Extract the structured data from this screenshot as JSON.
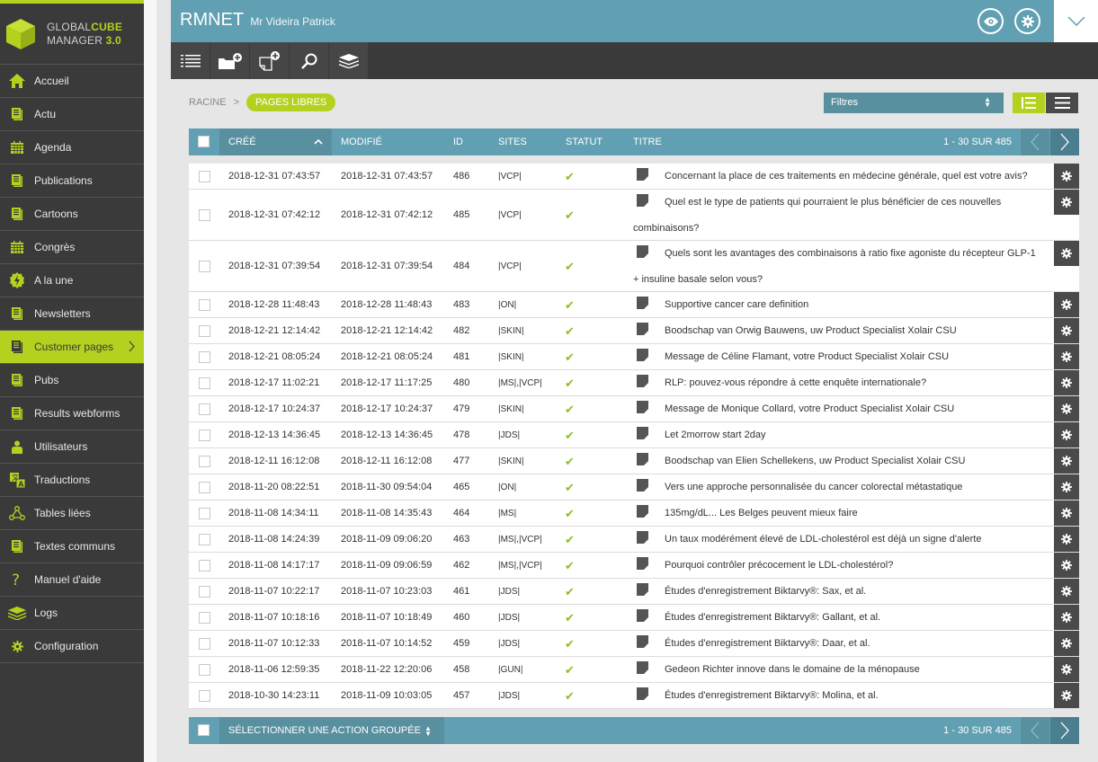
{
  "app": {
    "logo_line1_a": "GLOBAL",
    "logo_line1_b": "CUBE",
    "logo_line2_a": "MANAGER ",
    "logo_line2_b": "3.0",
    "accent_color": "#b5d11f",
    "primary_color": "#61a0b2"
  },
  "sidebar": {
    "items": [
      {
        "label": "Accueil",
        "icon": "home-icon"
      },
      {
        "label": "Actu",
        "icon": "document-icon"
      },
      {
        "label": "Agenda",
        "icon": "calendar-icon"
      },
      {
        "label": "Publications",
        "icon": "document-icon"
      },
      {
        "label": "Cartoons",
        "icon": "document-icon"
      },
      {
        "label": "Congrès",
        "icon": "calendar-icon"
      },
      {
        "label": "A la une",
        "icon": "lightning-icon"
      },
      {
        "label": "Newsletters",
        "icon": "document-icon"
      },
      {
        "label": "Customer pages",
        "icon": "document-icon",
        "active": true
      },
      {
        "label": "Pubs",
        "icon": "document-icon"
      },
      {
        "label": "Results webforms",
        "icon": "document-icon"
      },
      {
        "label": "Utilisateurs",
        "icon": "user-icon"
      },
      {
        "label": "Traductions",
        "icon": "translate-icon"
      },
      {
        "label": "Tables liées",
        "icon": "linked-nodes-icon"
      },
      {
        "label": "Textes communs",
        "icon": "document-icon"
      },
      {
        "label": "Manuel d'aide",
        "icon": "question-icon"
      },
      {
        "label": "Logs",
        "icon": "layers-icon"
      },
      {
        "label": "Configuration",
        "icon": "gear-icon"
      }
    ]
  },
  "header": {
    "title": "RMNET",
    "subtitle": "Mr Videira Patrick"
  },
  "toolbar": {
    "buttons": [
      "list-icon",
      "add-folder-icon",
      "add-page-icon",
      "search-icon",
      "layers-icon"
    ]
  },
  "breadcrumb": {
    "root": "RACINE",
    "separator": ">",
    "current": "PAGES LIBRES"
  },
  "filters": {
    "label": "Filtres"
  },
  "table": {
    "columns": {
      "cree": "CRÉÉ",
      "modifie": "MODIFIÉ",
      "id": "ID",
      "sites": "SITES",
      "statut": "STATUT",
      "titre": "TITRE"
    },
    "pagination": "1 - 30 SUR 485",
    "rows": [
      {
        "cree": "2018-12-31 07:43:57",
        "modifie": "2018-12-31 07:43:57",
        "id": "486",
        "sites": "|VCP|",
        "statut": "✔",
        "titre": "Concernant la place de ces traitements en médecine générale, quel est votre avis?",
        "lines": 1
      },
      {
        "cree": "2018-12-31 07:42:12",
        "modifie": "2018-12-31 07:42:12",
        "id": "485",
        "sites": "|VCP|",
        "statut": "✔",
        "titre": "Quel est le type de patients qui pourraient le plus bénéficier de ces nouvelles combinaisons?",
        "lines": 2
      },
      {
        "cree": "2018-12-31 07:39:54",
        "modifie": "2018-12-31 07:39:54",
        "id": "484",
        "sites": "|VCP|",
        "statut": "✔",
        "titre": "Quels sont les avantages des combinaisons à ratio fixe agoniste du récepteur GLP-1 + insuline basale selon vous?",
        "lines": 2
      },
      {
        "cree": "2018-12-28 11:48:43",
        "modifie": "2018-12-28 11:48:43",
        "id": "483",
        "sites": "|ON|",
        "statut": "✔",
        "titre": "Supportive cancer care definition",
        "lines": 1
      },
      {
        "cree": "2018-12-21 12:14:42",
        "modifie": "2018-12-21 12:14:42",
        "id": "482",
        "sites": "|SKIN|",
        "statut": "✔",
        "titre": "Boodschap van Orwig Bauwens, uw Product Specialist Xolair CSU",
        "lines": 1
      },
      {
        "cree": "2018-12-21 08:05:24",
        "modifie": "2018-12-21 08:05:24",
        "id": "481",
        "sites": "|SKIN|",
        "statut": "✔",
        "titre": "Message de Céline Flamant, votre Product Specialist Xolair CSU",
        "lines": 1
      },
      {
        "cree": "2018-12-17 11:02:21",
        "modifie": "2018-12-17 11:17:25",
        "id": "480",
        "sites": "|MS|,|VCP|",
        "statut": "✔",
        "titre": "RLP: pouvez-vous répondre à cette enquête internationale?",
        "lines": 1
      },
      {
        "cree": "2018-12-17 10:24:37",
        "modifie": "2018-12-17 10:24:37",
        "id": "479",
        "sites": "|SKIN|",
        "statut": "✔",
        "titre": "Message de Monique Collard, votre Product Specialist Xolair CSU",
        "lines": 1
      },
      {
        "cree": "2018-12-13 14:36:45",
        "modifie": "2018-12-13 14:36:45",
        "id": "478",
        "sites": "|JDS|",
        "statut": "✔",
        "titre": "Let 2morrow start 2day",
        "lines": 1
      },
      {
        "cree": "2018-12-11 16:12:08",
        "modifie": "2018-12-11 16:12:08",
        "id": "477",
        "sites": "|SKIN|",
        "statut": "✔",
        "titre": "Boodschap van Elien Schellekens, uw Product Specialist Xolair CSU",
        "lines": 1
      },
      {
        "cree": "2018-11-20 08:22:51",
        "modifie": "2018-11-30 09:54:04",
        "id": "465",
        "sites": "|ON|",
        "statut": "✔",
        "titre": "Vers une approche personnalisée du cancer colorectal métastatique",
        "lines": 1
      },
      {
        "cree": "2018-11-08 14:34:11",
        "modifie": "2018-11-08 14:35:43",
        "id": "464",
        "sites": "|MS|",
        "statut": "✔",
        "titre": "135mg/dL... Les Belges peuvent mieux faire",
        "lines": 1
      },
      {
        "cree": "2018-11-08 14:24:39",
        "modifie": "2018-11-09 09:06:20",
        "id": "463",
        "sites": "|MS|,|VCP|",
        "statut": "✔",
        "titre": "Un taux modérément élevé de LDL-cholestérol est déjà un signe d'alerte",
        "lines": 1
      },
      {
        "cree": "2018-11-08 14:17:17",
        "modifie": "2018-11-09 09:06:59",
        "id": "462",
        "sites": "|MS|,|VCP|",
        "statut": "✔",
        "titre": "Pourquoi contrôler précocement le LDL-cholestérol?",
        "lines": 1
      },
      {
        "cree": "2018-11-07 10:22:17",
        "modifie": "2018-11-07 10:23:03",
        "id": "461",
        "sites": "|JDS|",
        "statut": "✔",
        "titre": "Études d'enregistrement Biktarvy®: Sax, et al.",
        "lines": 1
      },
      {
        "cree": "2018-11-07 10:18:16",
        "modifie": "2018-11-07 10:18:49",
        "id": "460",
        "sites": "|JDS|",
        "statut": "✔",
        "titre": "Études d'enregistrement Biktarvy®: Gallant, et al.",
        "lines": 1
      },
      {
        "cree": "2018-11-07 10:12:33",
        "modifie": "2018-11-07 10:14:52",
        "id": "459",
        "sites": "|JDS|",
        "statut": "✔",
        "titre": "Études d'enregistrement Biktarvy®: Daar, et al.",
        "lines": 1
      },
      {
        "cree": "2018-11-06 12:59:35",
        "modifie": "2018-11-22 12:20:06",
        "id": "458",
        "sites": "|GUN|",
        "statut": "✔",
        "titre": "Gedeon Richter innove dans le domaine de la ménopause",
        "lines": 1
      },
      {
        "cree": "2018-10-30 14:23:11",
        "modifie": "2018-11-09 10:03:05",
        "id": "457",
        "sites": "|JDS|",
        "statut": "✔",
        "titre": "Études d'enregistrement Biktarvy®: Molina, et al.",
        "lines": 1
      }
    ]
  },
  "footer": {
    "bulk_action_label": "SÉLECTIONNER UNE ACTION GROUPÉE",
    "pagination": "1 - 30 SUR 485"
  }
}
